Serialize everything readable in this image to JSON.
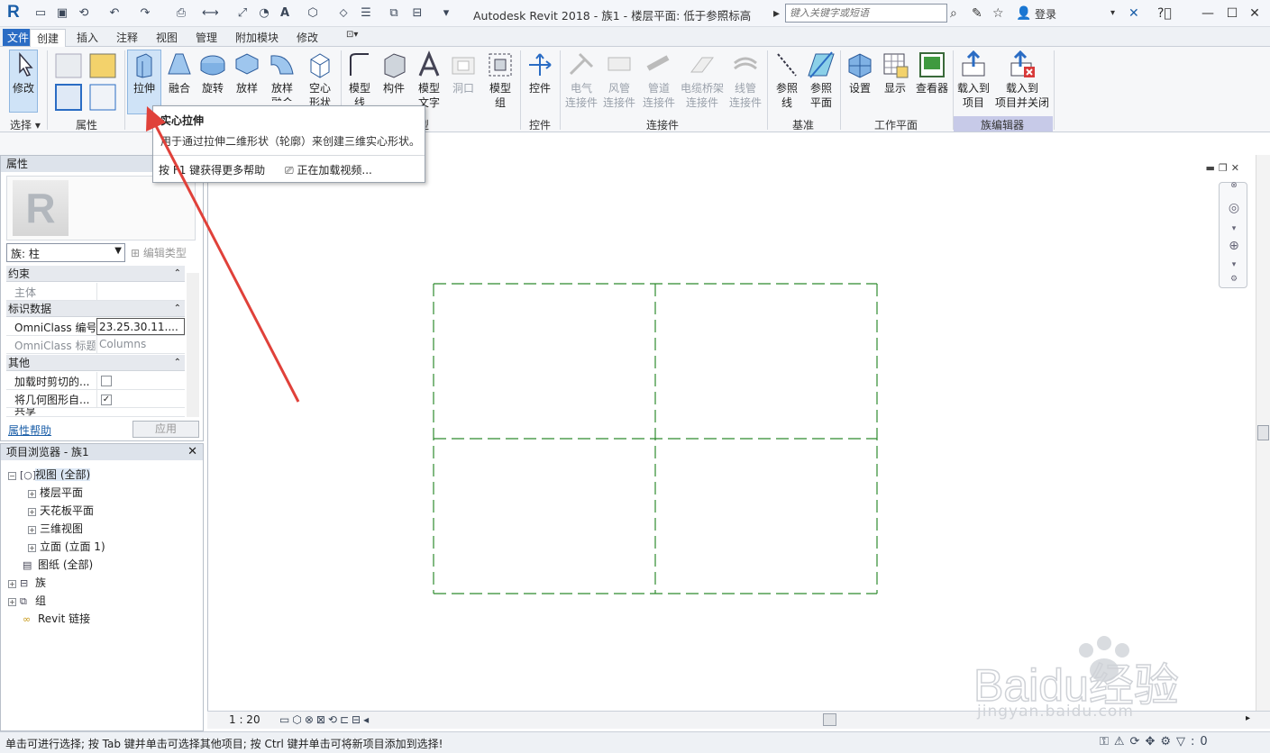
{
  "app": {
    "title": "Autodesk Revit 2018 -    族1 - 楼层平面: 低于参照标高",
    "logo": "R"
  },
  "search": {
    "placeholder": "键入关键字或短语"
  },
  "user": {
    "login_label": "登录"
  },
  "tabs": [
    {
      "label": "文件"
    },
    {
      "label": "创建"
    },
    {
      "label": "插入"
    },
    {
      "label": "注释"
    },
    {
      "label": "视图"
    },
    {
      "label": "管理"
    },
    {
      "label": "附加模块"
    },
    {
      "label": "修改"
    }
  ],
  "ribbon": {
    "modify": "修改",
    "extrude": "拉伸",
    "blend": "融合",
    "revolve": "旋转",
    "sweep": "放样",
    "swept_blend": "放样\n融合",
    "void": "空心\n形状",
    "model_line": "模型\n线",
    "component": "构件",
    "model_text": "模型\n文字",
    "opening": "洞口",
    "model_group": "模型\n组",
    "control": "控件",
    "electrical": "电气\n连接件",
    "duct": "风管\n连接件",
    "pipe": "管道\n连接件",
    "cable_tray": "电缆桥架\n连接件",
    "conduit": "线管\n连接件",
    "ref_line": "参照\n线",
    "ref_plane": "参照\n平面",
    "set": "设置",
    "show": "显示",
    "viewer": "查看器",
    "load_into": "载入到\n项目",
    "load_close": "载入到\n项目并关闭",
    "panels": {
      "select": "选择 ▾",
      "properties": "属性",
      "model": "模型",
      "control": "控件",
      "connectors": "连接件",
      "datum": "基准",
      "work_plane": "工作平面",
      "family_editor": "族编辑器"
    }
  },
  "tooltip": {
    "title": "实心拉伸",
    "description": "用于通过拉伸二维形状（轮廓）来创建三维实心形状。",
    "help": "按 F1 键获得更多帮助",
    "video": "正在加载视频..."
  },
  "properties": {
    "header": "属性",
    "family_selector": "族: 柱",
    "edit_type": "编辑类型",
    "groups": {
      "constraints": "约束",
      "identity": "标识数据",
      "other": "其他"
    },
    "rows": {
      "host_key": "主体",
      "omniclass_num_key": "OmniClass 编号",
      "omniclass_num_val": "23.25.30.11....",
      "omniclass_title_key": "OmniClass 标题",
      "omniclass_title_val": "Columns",
      "cut_on_load_key": "加载时剪切的...",
      "auto_join_key": "将几何图形自...",
      "shared_key": "共享"
    },
    "help_link": "属性帮助",
    "apply": "应用"
  },
  "browser": {
    "header": "项目浏览器 - 族1",
    "nodes": {
      "views": "视图 (全部)",
      "floor_plans": "楼层平面",
      "ceiling_plans": "天花板平面",
      "views_3d": "三维视图",
      "elevations": "立面 (立面 1)",
      "sheets": "图纸 (全部)",
      "families": "族",
      "groups": "组",
      "revit_links": "Revit 链接"
    }
  },
  "viewbar": {
    "scale": "1 : 20"
  },
  "status": {
    "text": "单击可进行选择; 按 Tab 键并单击可选择其他项目; 按 Ctrl 键并单击可将新项目添加到选择!",
    "filter_count": ":0"
  },
  "watermark": {
    "brand": "Baidu经验",
    "url": "jingyan.baidu.com"
  },
  "colors": {
    "accent": "#2a6cc4",
    "ref_plane": "#2e8b2e",
    "arrow": "#e0413a"
  },
  "icons": [
    "open-icon",
    "save-icon",
    "undo-icon",
    "redo-icon",
    "print-icon",
    "binoculars-icon",
    "star-icon",
    "user-icon",
    "help-icon",
    "close-icon"
  ]
}
